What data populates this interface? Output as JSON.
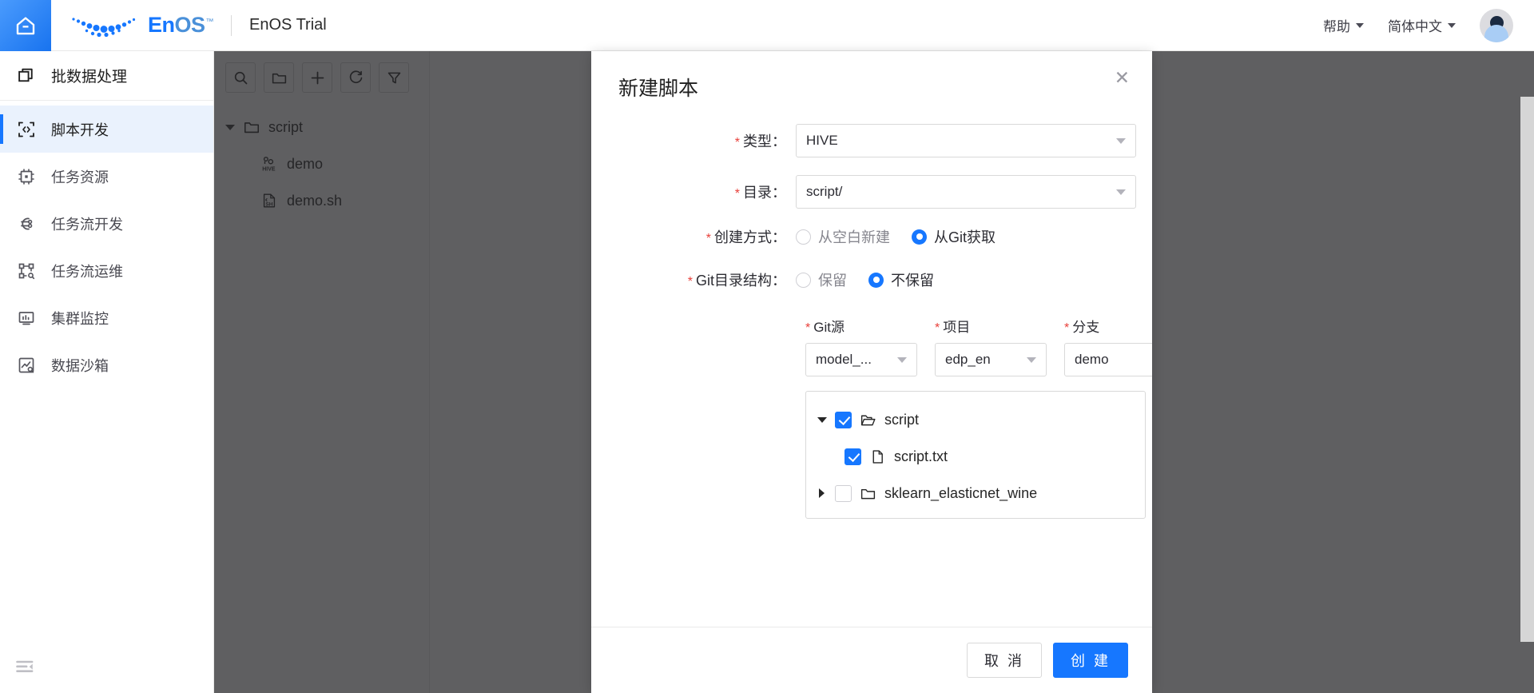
{
  "header": {
    "home_icon": "home-icon",
    "brand_en": "En",
    "brand_os": "OS",
    "brand_tm": "™",
    "app_title": "EnOS Trial",
    "help_label": "帮助",
    "language_label": "简体中文",
    "avatar_icon": "user-avatar-icon"
  },
  "sidebar": {
    "section_title": "批数据处理",
    "section_icon": "batch-data-icon",
    "collapse_icon": "collapse-menu-icon",
    "items": [
      {
        "label": "脚本开发",
        "icon": "script-dev-icon",
        "active": true
      },
      {
        "label": "任务资源",
        "icon": "task-resource-icon",
        "active": false
      },
      {
        "label": "任务流开发",
        "icon": "workflow-dev-icon",
        "active": false
      },
      {
        "label": "任务流运维",
        "icon": "workflow-ops-icon",
        "active": false
      },
      {
        "label": "集群监控",
        "icon": "cluster-monitor-icon",
        "active": false
      },
      {
        "label": "数据沙箱",
        "icon": "data-sandbox-icon",
        "active": false
      }
    ]
  },
  "file_panel": {
    "toolbar": [
      {
        "name": "search-icon",
        "title": "搜索"
      },
      {
        "name": "new-folder-icon",
        "title": "新建文件夹"
      },
      {
        "name": "plus-icon",
        "title": "新建"
      },
      {
        "name": "refresh-icon",
        "title": "刷新"
      },
      {
        "name": "filter-icon",
        "title": "筛选"
      }
    ],
    "tree": [
      {
        "label": "script",
        "icon": "folder-icon",
        "level": 0,
        "expanded": true
      },
      {
        "label": "demo",
        "icon": "hive-file-icon",
        "level": 1
      },
      {
        "label": "demo.sh",
        "icon": "sh-file-icon",
        "level": 1
      }
    ],
    "expand_handle": ">>"
  },
  "modal": {
    "title": "新建脚本",
    "close_icon": "close-icon",
    "fields": {
      "type_label": "类型：",
      "type_value": "HIVE",
      "dir_label": "目录：",
      "dir_value": "script/",
      "create_mode_label": "创建方式：",
      "create_mode_options": [
        {
          "label": "从空白新建",
          "selected": false
        },
        {
          "label": "从Git获取",
          "selected": true
        }
      ],
      "git_struct_label": "Git目录结构：",
      "git_struct_options": [
        {
          "label": "保留",
          "selected": false
        },
        {
          "label": "不保留",
          "selected": true
        }
      ],
      "git_source_label": "Git源",
      "git_source_value": "model_...",
      "project_label": "项目",
      "project_value": "edp_en",
      "branch_label": "分支",
      "branch_value": "demo"
    },
    "git_tree": [
      {
        "label": "script",
        "icon": "folder-open-icon",
        "level": 0,
        "checked": true,
        "expanded": true,
        "toggle": "down"
      },
      {
        "label": "script.txt",
        "icon": "file-icon",
        "level": 1,
        "checked": true,
        "toggle": "none"
      },
      {
        "label": "sklearn_elasticnet_wine",
        "icon": "folder-icon",
        "level": 0,
        "checked": false,
        "expanded": false,
        "toggle": "right"
      }
    ],
    "cancel_label": "取 消",
    "create_label": "创 建"
  },
  "colors": {
    "accent": "#1677ff",
    "required": "#e8403a",
    "overlay": "#272d2f",
    "sidebar_active_bg": "#eaf2fd"
  }
}
